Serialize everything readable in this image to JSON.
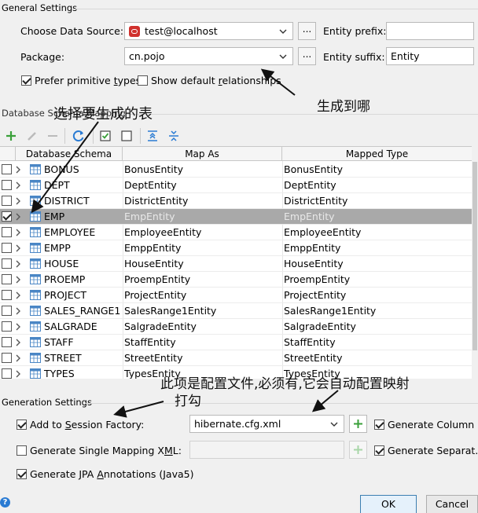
{
  "general": {
    "title": "General Settings",
    "data_source_label": "Choose Data Source:",
    "data_source_value": "test@localhost",
    "browse_label": "...",
    "entity_prefix_label": "Entity prefix:",
    "entity_prefix_value": "",
    "package_label": "Package:",
    "package_value": "cn.pojo",
    "entity_suffix_label": "Entity suffix:",
    "entity_suffix_value": "Entity",
    "prefer_primitive_label": "Prefer primitive types",
    "show_default_rel_label": "Show default relationships"
  },
  "schema": {
    "title": "Database Schema Mapping",
    "columns": [
      "Database Schema",
      "Map As",
      "Mapped Type"
    ],
    "rows": [
      {
        "name": "BONUS",
        "map_as": "BonusEntity",
        "type": "BonusEntity",
        "checked": false
      },
      {
        "name": "DEPT",
        "map_as": "DeptEntity",
        "type": "DeptEntity",
        "checked": false
      },
      {
        "name": "DISTRICT",
        "map_as": "DistrictEntity",
        "type": "DistrictEntity",
        "checked": false
      },
      {
        "name": "EMP",
        "map_as": "EmpEntity",
        "type": "EmpEntity",
        "checked": true
      },
      {
        "name": "EMPLOYEE",
        "map_as": "EmployeeEntity",
        "type": "EmployeeEntity",
        "checked": false
      },
      {
        "name": "EMPP",
        "map_as": "EmppEntity",
        "type": "EmppEntity",
        "checked": false
      },
      {
        "name": "HOUSE",
        "map_as": "HouseEntity",
        "type": "HouseEntity",
        "checked": false
      },
      {
        "name": "PROEMP",
        "map_as": "ProempEntity",
        "type": "ProempEntity",
        "checked": false
      },
      {
        "name": "PROJECT",
        "map_as": "ProjectEntity",
        "type": "ProjectEntity",
        "checked": false
      },
      {
        "name": "SALES_RANGE1",
        "map_as": "SalesRange1Entity",
        "type": "SalesRange1Entity",
        "checked": false
      },
      {
        "name": "SALGRADE",
        "map_as": "SalgradeEntity",
        "type": "SalgradeEntity",
        "checked": false
      },
      {
        "name": "STAFF",
        "map_as": "StaffEntity",
        "type": "StaffEntity",
        "checked": false
      },
      {
        "name": "STREET",
        "map_as": "StreetEntity",
        "type": "StreetEntity",
        "checked": false
      },
      {
        "name": "TYPES",
        "map_as": "TypesEntity",
        "type": "TypesEntity",
        "checked": false
      }
    ]
  },
  "generation": {
    "title": "Generation Settings",
    "add_session_label": "Add to Session Factory:",
    "session_value": "hibernate.cfg.xml",
    "gen_column_label": "Generate Column ...",
    "single_mapping_label": "Generate Single Mapping XML:",
    "gen_separate_label": "Generate Separat...",
    "jpa_label": "Generate JPA Annotations (Java5)"
  },
  "buttons": {
    "ok": "OK",
    "cancel": "Cancel",
    "help": "?"
  },
  "annotations": {
    "select_tables": "选择要生成的表",
    "generate_to": "生成到哪",
    "config_note": "此项是配置文件,必须有,它会自动配置映射",
    "check_note": "打勾"
  },
  "colors": {
    "selected_row": "#a9a9a9",
    "accent_green": "#3aa03a",
    "accent_blue": "#2a7bd3",
    "oracle_red": "#d0312d"
  }
}
